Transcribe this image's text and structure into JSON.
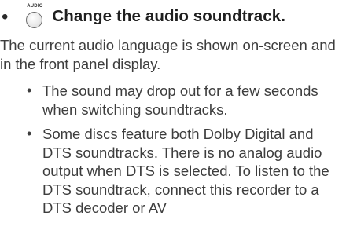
{
  "heading": {
    "bullet": "•",
    "button_caption": "AUDIO",
    "button_icon": "audio-button-icon",
    "text": "Change the audio soundtrack."
  },
  "intro": "The current audio language is shown on-screen and in the front panel display.",
  "notes": [
    {
      "bullet": "•",
      "text": "The sound may drop out for a few seconds when switching soundtracks."
    },
    {
      "bullet": "•",
      "text": "Some discs feature both Dolby Digital and DTS soundtracks. There is no analog audio output when DTS is selected. To listen to the DTS soundtrack, connect this recorder to a DTS decoder or AV"
    }
  ]
}
